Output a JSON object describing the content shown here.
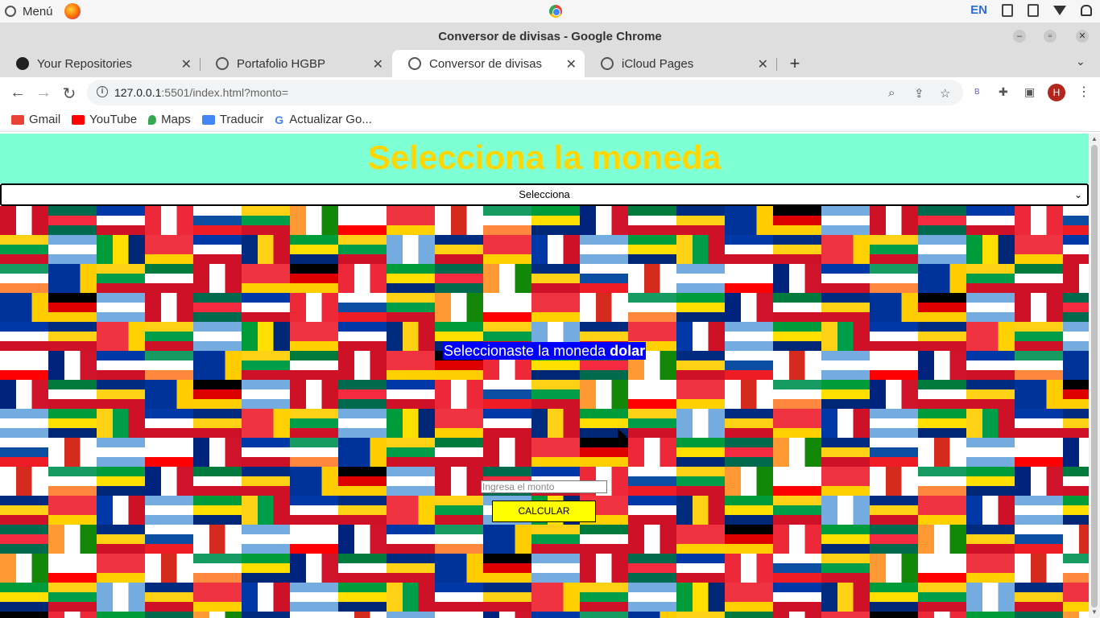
{
  "os": {
    "menu_label": "Menú",
    "lang": "EN"
  },
  "window": {
    "title": "Conversor de divisas - Google Chrome"
  },
  "tabs": [
    {
      "label": "Your Repositories"
    },
    {
      "label": "Portafolio HGBP"
    },
    {
      "label": "Conversor de divisas"
    },
    {
      "label": "iCloud Pages"
    }
  ],
  "address": {
    "host": "127.0.0.1",
    "path": ":5501/index.html?monto="
  },
  "profile": {
    "initial": "H"
  },
  "bookmarks": [
    {
      "label": "Gmail",
      "icon": "gmail-icon",
      "color": "#ea4335"
    },
    {
      "label": "YouTube",
      "icon": "youtube-icon",
      "color": "#ff0000"
    },
    {
      "label": "Maps",
      "icon": "maps-icon",
      "color": "#34a853"
    },
    {
      "label": "Traducir",
      "icon": "translate-icon",
      "color": "#4285f4"
    },
    {
      "label": "Actualizar Go...",
      "icon": "google-icon",
      "color": "#4285f4"
    }
  ],
  "page": {
    "heading": "Selecciona la moneda",
    "select_value": "Selecciona",
    "message_prefix": "Seleccionaste la moneda ",
    "message_currency": "dolar",
    "amount_placeholder": "Ingresa el monto",
    "calc_label": "CALCULAR"
  },
  "colors": {
    "header_bg": "#7fffd4",
    "heading": "#ffd700",
    "message_bg": "#0000ff",
    "button_bg": "#ffff00"
  }
}
